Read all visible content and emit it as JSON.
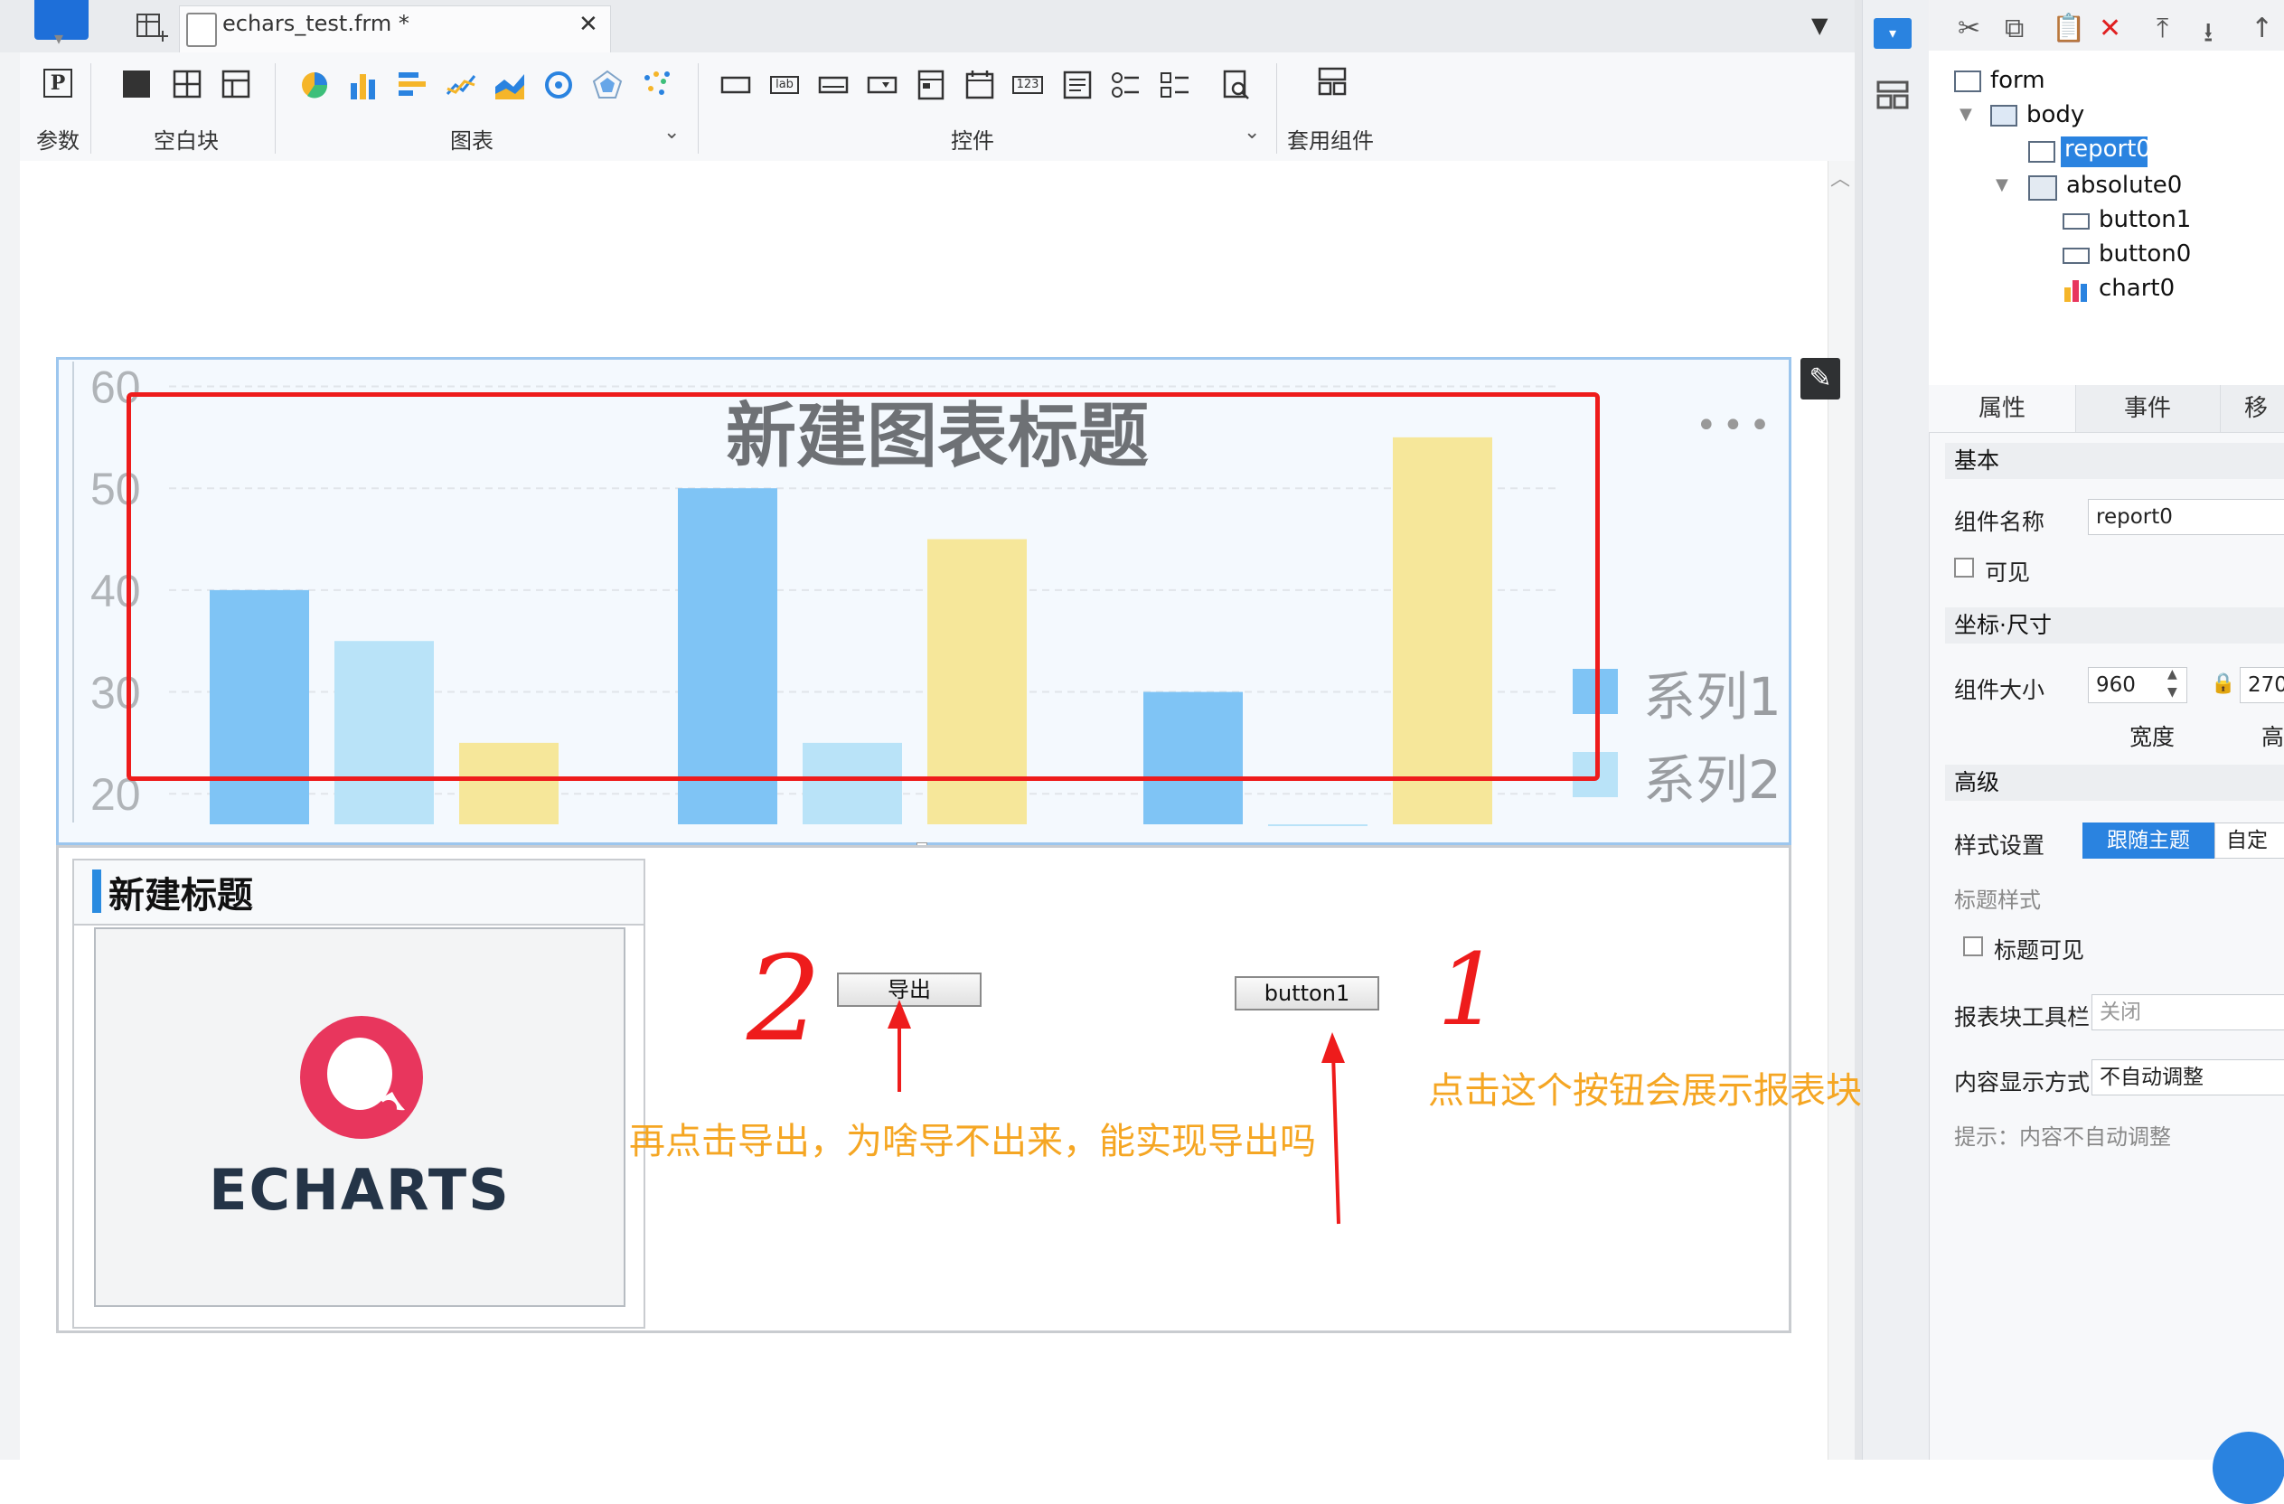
{
  "tab": {
    "title": "echars_test.frm *",
    "close": "✕"
  },
  "toolbar": {
    "groups": {
      "param": "参数",
      "blank": "空白块",
      "chart": "图表",
      "control": "控件",
      "widget": "套用组件"
    },
    "chart_caret": "⌄",
    "control_caret": "⌄",
    "control_lab_icon_text": "lab",
    "control_123_icon_text": "123"
  },
  "chart": {
    "title": "新建图表标题",
    "menu": "•••",
    "legend": [
      "系列1",
      "系列2"
    ],
    "colors": {
      "bar_blue": "#7fc4f5",
      "bar_lightblue": "#b9e3f8",
      "bar_yellow": "#f6e79a"
    }
  },
  "chart_data": {
    "type": "bar",
    "title": "新建图表标题",
    "y_ticks_visible": [
      20,
      30,
      40,
      50,
      60
    ],
    "ylim_visible": [
      17,
      62
    ],
    "categories": [
      "",
      "",
      ""
    ],
    "series": [
      {
        "name": "系列1",
        "values": [
          40,
          50,
          30
        ]
      },
      {
        "name": "系列2",
        "values": [
          35,
          25,
          17
        ]
      },
      {
        "name": "",
        "values": [
          25,
          45,
          55
        ]
      }
    ],
    "legend": [
      "系列1",
      "系列2"
    ],
    "legend_position": "right",
    "grid": true
  },
  "chart0": {
    "header_title": "新建标题",
    "logo_text": "ECHARTS"
  },
  "buttons": {
    "export_label": "导出",
    "button1_label": "button1"
  },
  "annotations": {
    "num2": "2",
    "num1": "1",
    "note1": "点击这个按钮会展示报表块",
    "note2": "再点击导出，为啥导不出来，能实现导出吗"
  },
  "tree": {
    "form": "form",
    "body": "body",
    "report0": "report0",
    "absolute0": "absolute0",
    "button1": "button1",
    "button0": "button0",
    "chart0": "chart0"
  },
  "panel": {
    "tabs": {
      "attr": "属性",
      "event": "事件",
      "move": "移"
    },
    "section_basic": "基本",
    "name_label": "组件名称",
    "name_value": "report0",
    "visible_label": "可见",
    "section_coords": "坐标·尺寸",
    "size_label": "组件大小",
    "width_value": "960",
    "height_value": "270",
    "width_caption": "宽度",
    "height_caption": "高",
    "section_advanced": "高级",
    "style_label": "样式设置",
    "style_theme": "跟随主题",
    "style_custom": "自定",
    "title_style_label": "标题样式",
    "title_visible_label": "标题可见",
    "toolbar_label": "报表块工具栏",
    "toolbar_value": "关闭",
    "display_label": "内容显示方式",
    "display_value": "不自动调整",
    "hint": "提示：内容不自动调整"
  }
}
